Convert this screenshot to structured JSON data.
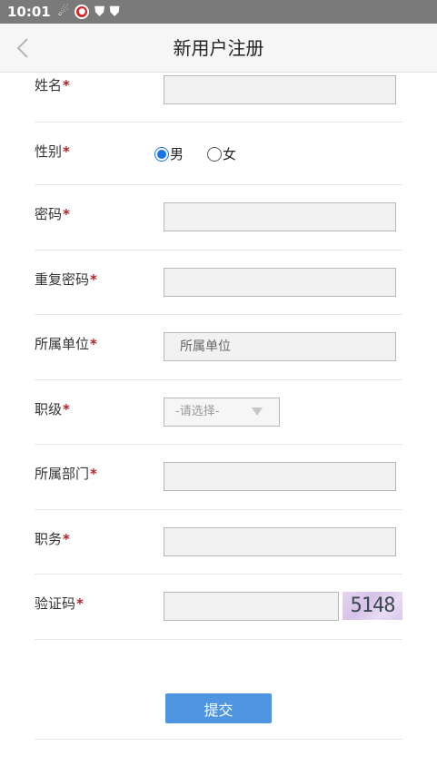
{
  "status_bar": {
    "time": "10:01"
  },
  "header": {
    "title": "新用户注册"
  },
  "form": {
    "name": {
      "label": "姓名",
      "value": ""
    },
    "gender": {
      "label": "性别",
      "options": [
        "男",
        "女"
      ],
      "selected": "男"
    },
    "password": {
      "label": "密码",
      "value": ""
    },
    "confirm_password": {
      "label": "重复密码",
      "value": ""
    },
    "unit": {
      "label": "所属单位",
      "placeholder": "所属单位"
    },
    "rank": {
      "label": "职级",
      "selected": "-请选择-"
    },
    "department": {
      "label": "所属部门",
      "value": ""
    },
    "position": {
      "label": "职务",
      "value": ""
    },
    "captcha": {
      "label": "验证码",
      "value": "",
      "image_text": "5148"
    },
    "required_mark": "*"
  },
  "submit_label": "提交",
  "colors": {
    "accent": "#4f95e2",
    "required": "#b0232a",
    "status_bar": "#7a7a7a"
  }
}
